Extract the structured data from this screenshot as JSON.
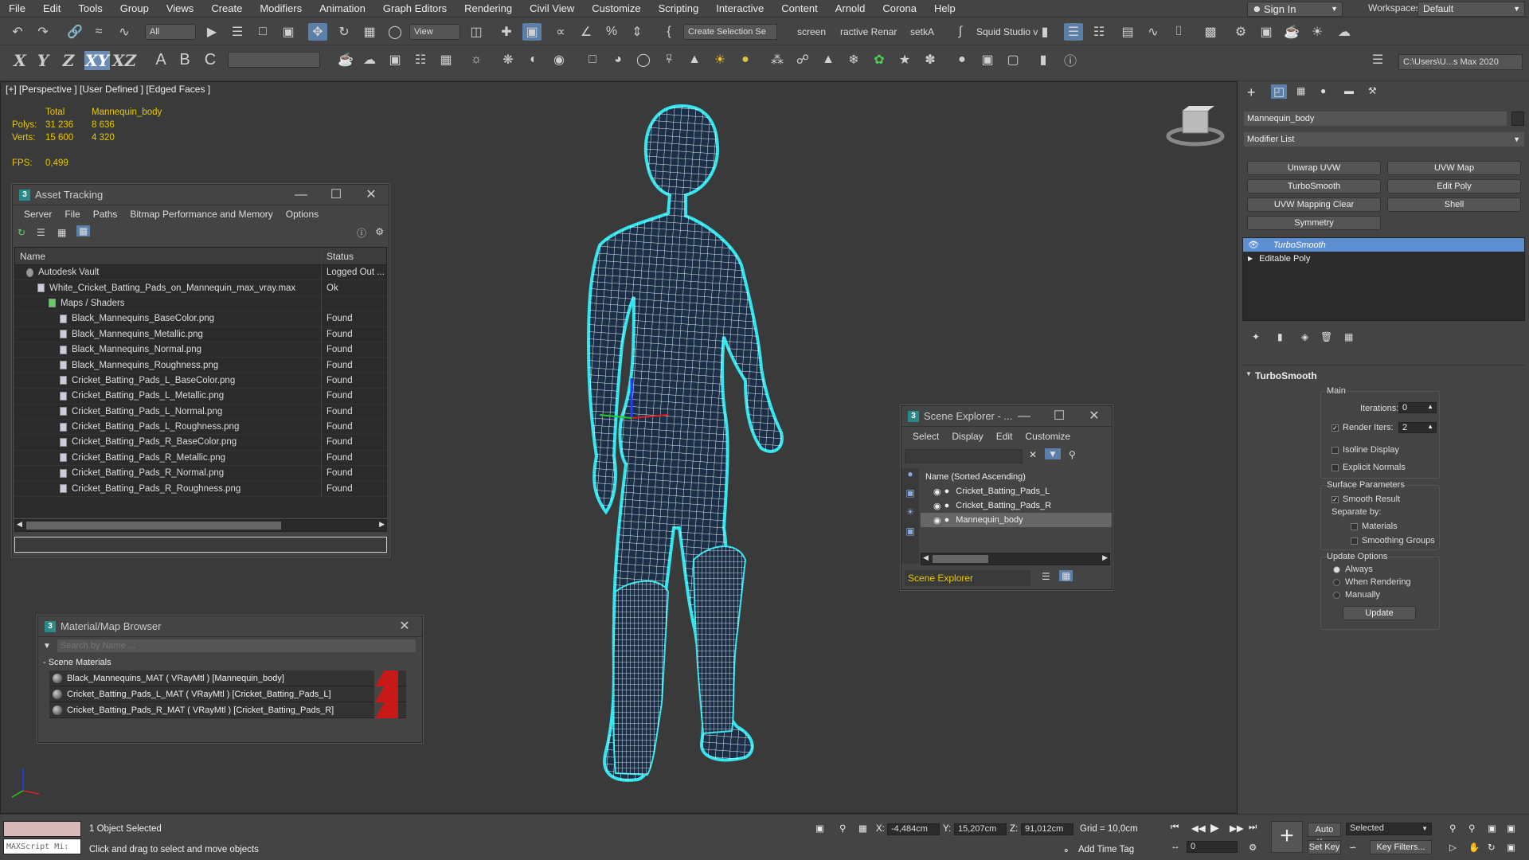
{
  "menubar": {
    "items": [
      "File",
      "Edit",
      "Tools",
      "Group",
      "Views",
      "Create",
      "Modifiers",
      "Animation",
      "Graph Editors",
      "Rendering",
      "Civil View",
      "Customize",
      "Scripting",
      "Interactive",
      "Content",
      "Arnold",
      "Corona",
      "Help"
    ],
    "sign_in": "Sign In",
    "workspaces_label": "Workspaces:",
    "workspaces_value": "Default"
  },
  "toolbar1": {
    "filter": "All",
    "ref_coord": "View",
    "selection_set": "Create Selection Se",
    "tabs": [
      "screen",
      "ractive Renar",
      "setkA",
      "Squid Studio v"
    ]
  },
  "toolbar2": {
    "axes": [
      "X",
      "Y",
      "Z",
      "XY",
      "XZ"
    ],
    "project_path": "C:\\Users\\U...s Max 2020"
  },
  "viewport": {
    "label": "[+] [Perspective ] [User Defined ] [Edged Faces ]",
    "stats": {
      "total_label": "Total",
      "object_label": "Mannequin_body",
      "polys_label": "Polys:",
      "polys_total": "31 236",
      "polys_object": "8 636",
      "verts_label": "Verts:",
      "verts_total": "15 600",
      "verts_object": "4 320",
      "fps_label": "FPS:",
      "fps_value": "0,499"
    }
  },
  "asset_tracking": {
    "title": "Asset Tracking",
    "menu": [
      "Server",
      "File",
      "Paths",
      "Bitmap Performance and Memory",
      "Options"
    ],
    "col_name": "Name",
    "col_status": "Status",
    "rows": [
      {
        "name": "Autodesk Vault",
        "status": "Logged Out ...",
        "indent": 1
      },
      {
        "name": "White_Cricket_Batting_Pads_on_Mannequin_max_vray.max",
        "status": "Ok",
        "indent": 2
      },
      {
        "name": "Maps / Shaders",
        "status": "",
        "indent": 3
      },
      {
        "name": "Black_Mannequins_BaseColor.png",
        "status": "Found",
        "indent": 4
      },
      {
        "name": "Black_Mannequins_Metallic.png",
        "status": "Found",
        "indent": 4
      },
      {
        "name": "Black_Mannequins_Normal.png",
        "status": "Found",
        "indent": 4
      },
      {
        "name": "Black_Mannequins_Roughness.png",
        "status": "Found",
        "indent": 4
      },
      {
        "name": "Cricket_Batting_Pads_L_BaseColor.png",
        "status": "Found",
        "indent": 4
      },
      {
        "name": "Cricket_Batting_Pads_L_Metallic.png",
        "status": "Found",
        "indent": 4
      },
      {
        "name": "Cricket_Batting_Pads_L_Normal.png",
        "status": "Found",
        "indent": 4
      },
      {
        "name": "Cricket_Batting_Pads_L_Roughness.png",
        "status": "Found",
        "indent": 4
      },
      {
        "name": "Cricket_Batting_Pads_R_BaseColor.png",
        "status": "Found",
        "indent": 4
      },
      {
        "name": "Cricket_Batting_Pads_R_Metallic.png",
        "status": "Found",
        "indent": 4
      },
      {
        "name": "Cricket_Batting_Pads_R_Normal.png",
        "status": "Found",
        "indent": 4
      },
      {
        "name": "Cricket_Batting_Pads_R_Roughness.png",
        "status": "Found",
        "indent": 4
      }
    ]
  },
  "material_browser": {
    "title": "Material/Map Browser",
    "search_placeholder": "Search by Name ...",
    "group_label": "- Scene Materials",
    "items": [
      "Black_Mannequins_MAT ( VRayMtl ) [Mannequin_body]",
      "Cricket_Batting_Pads_L_MAT ( VRayMtl ) [Cricket_Batting_Pads_L]",
      "Cricket_Batting_Pads_R_MAT ( VRayMtl ) [Cricket_Batting_Pads_R]"
    ]
  },
  "scene_explorer": {
    "title": "Scene Explorer - ...",
    "menu": [
      "Select",
      "Display",
      "Edit",
      "Customize"
    ],
    "column": "Name (Sorted Ascending)",
    "items": [
      "Cricket_Batting_Pads_L",
      "Cricket_Batting_Pads_R",
      "Mannequin_body"
    ],
    "selected_index": 2,
    "footer": "Scene Explorer"
  },
  "command_panel": {
    "object_name": "Mannequin_body",
    "modifier_list": "Modifier List",
    "buttons": [
      "Unwrap UVW",
      "UVW Map",
      "TurboSmooth",
      "Edit Poly",
      "UVW Mapping Clear",
      "Shell",
      "Symmetry"
    ],
    "stack": [
      "TurboSmooth",
      "Editable Poly"
    ],
    "rollout_title": "TurboSmooth",
    "main_label": "Main",
    "iterations_label": "Iterations:",
    "iterations_value": "0",
    "render_iters_label": "Render Iters:",
    "render_iters_value": "2",
    "isoline_display": "Isoline Display",
    "explicit_normals": "Explicit Normals",
    "surface_params": "Surface Parameters",
    "smooth_result": "Smooth Result",
    "separate_by": "Separate by:",
    "materials": "Materials",
    "smoothing_groups": "Smoothing Groups",
    "update_options": "Update Options",
    "always": "Always",
    "when_rendering": "When Rendering",
    "manually": "Manually",
    "update_button": "Update"
  },
  "status": {
    "maxscript": "MAXScript Mi:",
    "selected_text": "1 Object Selected",
    "prompt": "Click and drag to select and move objects",
    "x_label": "X:",
    "x_value": "-4,484cm",
    "y_label": "Y:",
    "y_value": "15,207cm",
    "z_label": "Z:",
    "z_value": "91,012cm",
    "grid": "Grid = 10,0cm",
    "add_time_tag": "Add Time Tag",
    "auto_key": "Auto Key",
    "set_key": "Set Key",
    "selected_dropdown": "Selected",
    "key_filters": "Key Filters...",
    "frame": "0"
  },
  "colors": {
    "wire": "#ffffff",
    "selection_outline": "#33e6ee",
    "accent_blue": "#5b8fd1"
  }
}
